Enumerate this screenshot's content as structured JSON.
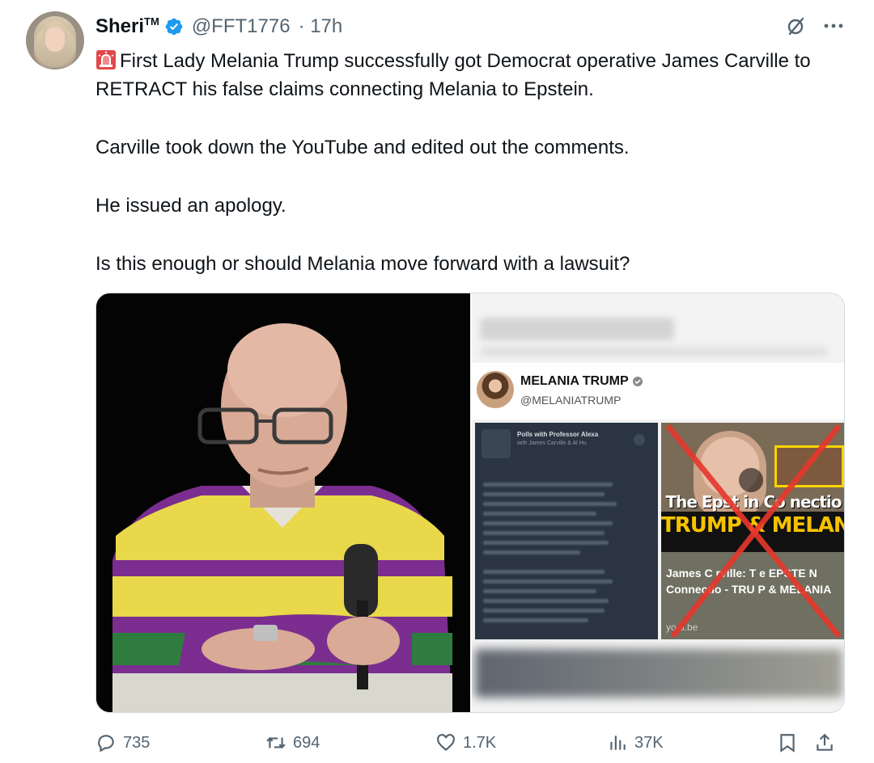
{
  "author": {
    "name": "Sheri",
    "name_suffix": "TM",
    "handle": "@FFT1776",
    "time": "· 17h",
    "verified": true
  },
  "icons": {
    "verified": "verified-badge-icon",
    "grok": "grok-icon",
    "more": "more-icon",
    "siren": "siren-emoji-icon",
    "reply": "reply-icon",
    "retweet": "retweet-icon",
    "like": "like-icon",
    "views": "views-icon",
    "bookmark": "bookmark-icon",
    "share": "share-icon"
  },
  "tweet": {
    "line1": "First Lady Melania Trump successfully got Democrat operative James Carville to RETRACT his false claims connecting Melania to Epstein.",
    "line2": "Carville took down the YouTube and edited out the comments.",
    "line3": "He issued an apology.",
    "line4": "Is this enough or should Melania move forward with a lawsuit?"
  },
  "media": {
    "embedded_post": {
      "name": "MELANIA TRUMP",
      "handle": "@MELANIATRUMP"
    },
    "screenshot_left": {
      "title": "Polls with Professor Alexa",
      "subtitle": "with James Carville & Al Hu"
    },
    "youtube_card": {
      "thumb_line1": "The Epst in Co nectio",
      "thumb_line2": "TRUMP & MELANIA",
      "title": "James C rville: T e EPSTE N Connectio - TRU P & MELANIA",
      "domain": "yo u.be"
    }
  },
  "actions": {
    "replies": "735",
    "retweets": "694",
    "likes": "1.7K",
    "views": "37K"
  },
  "colors": {
    "text": "#0f1419",
    "secondary": "#536471",
    "verified_blue": "#1d9bf0",
    "red_x": "#e6372b",
    "border": "#cfd9de"
  }
}
